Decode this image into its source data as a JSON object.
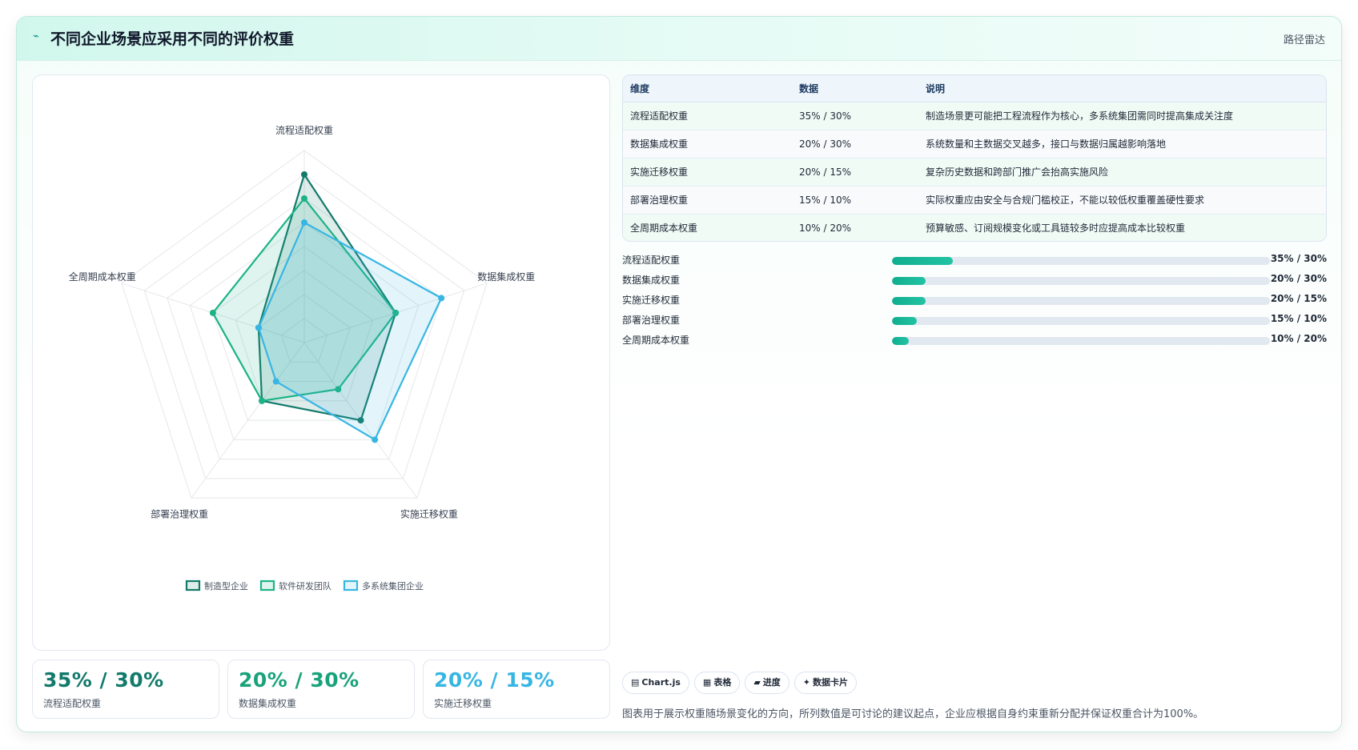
{
  "header": {
    "title": "不同企业场景应采用不同的评价权重",
    "tag": "路径雷达",
    "icon": "chart-line-icon"
  },
  "chart_data": {
    "type": "radar",
    "axes": [
      "流程适配权重",
      "数据集成权重",
      "实施迁移权重",
      "部署治理权重",
      "全周期成本权重"
    ],
    "range": [
      0,
      40
    ],
    "grid": true,
    "legend_position": "bottom",
    "series": [
      {
        "name": "制造型企业",
        "values": [
          35,
          20,
          20,
          15,
          10
        ],
        "color": "#137a6b"
      },
      {
        "name": "软件研发团队",
        "values": [
          30,
          20,
          12,
          15,
          20
        ],
        "color": "#1db386"
      },
      {
        "name": "多系统集团企业",
        "values": [
          25,
          30,
          25,
          10,
          10
        ],
        "color": "#38b6e3"
      }
    ]
  },
  "stats": [
    {
      "value": "35% / 30%",
      "label": "流程适配权重",
      "color": "#137a6b"
    },
    {
      "value": "20% / 30%",
      "label": "数据集成权重",
      "color": "#1aa37a"
    },
    {
      "value": "20% / 15%",
      "label": "实施迁移权重",
      "color": "#38b6e3"
    }
  ],
  "table": {
    "headers": [
      "维度",
      "数据",
      "说明"
    ],
    "rows": [
      [
        "流程适配权重",
        "35% / 30%",
        "制造场景更可能把工程流程作为核心，多系统集团需同时提高集成关注度"
      ],
      [
        "数据集成权重",
        "20% / 30%",
        "系统数量和主数据交叉越多，接口与数据归属越影响落地"
      ],
      [
        "实施迁移权重",
        "20% / 15%",
        "复杂历史数据和跨部门推广会抬高实施风险"
      ],
      [
        "部署治理权重",
        "15% / 10%",
        "实际权重应由安全与合规门槛校正，不能以较低权重覆盖硬性要求"
      ],
      [
        "全周期成本权重",
        "10% / 20%",
        "预算敏感、订阅规模变化或工具链较多时应提高成本比较权重"
      ]
    ]
  },
  "bars": [
    {
      "label": "流程适配权重",
      "value": "35% / 30%",
      "fill": 0.16
    },
    {
      "label": "数据集成权重",
      "value": "20% / 30%",
      "fill": 0.09
    },
    {
      "label": "实施迁移权重",
      "value": "20% / 15%",
      "fill": 0.09
    },
    {
      "label": "部署治理权重",
      "value": "15% / 10%",
      "fill": 0.065
    },
    {
      "label": "全周期成本权重",
      "value": "10% / 20%",
      "fill": 0.045
    }
  ],
  "chips": [
    {
      "icon": "▤",
      "label": "Chart.js"
    },
    {
      "icon": "▦",
      "label": "表格"
    },
    {
      "icon": "▰",
      "label": "进度"
    },
    {
      "icon": "✦",
      "label": "数据卡片"
    }
  ],
  "note": "图表用于展示权重随场景变化的方向，所列数值是可讨论的建议起点，企业应根据自身约束重新分配并保证权重合计为100%。"
}
